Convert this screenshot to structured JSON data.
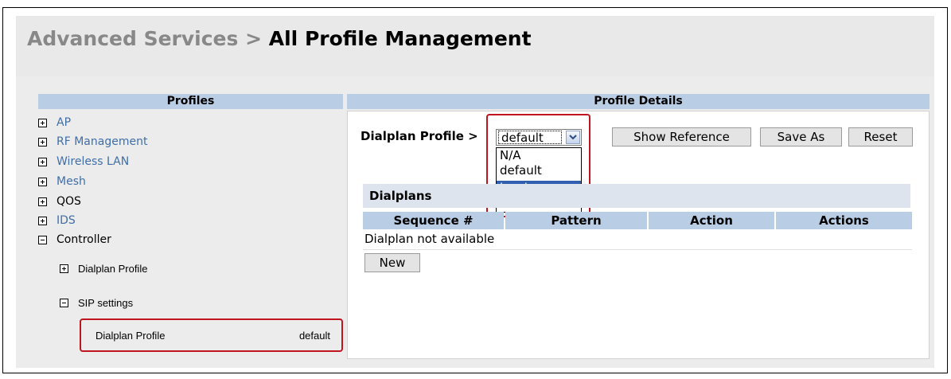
{
  "header": {
    "breadcrumb_parent": "Advanced Services > ",
    "page_title": "All Profile Management"
  },
  "profiles": {
    "header": "Profiles",
    "tree": [
      {
        "label": "AP",
        "expanded": false
      },
      {
        "label": "RF Management",
        "expanded": false
      },
      {
        "label": "Wireless LAN",
        "expanded": false
      },
      {
        "label": "Mesh",
        "expanded": false
      },
      {
        "label": "QOS",
        "expanded": false
      },
      {
        "label": "IDS",
        "expanded": false
      },
      {
        "label": "Controller",
        "expanded": true
      }
    ],
    "controller_children": [
      {
        "label": "Dialplan Profile",
        "expanded": false
      },
      {
        "label": "SIP settings",
        "expanded": true
      }
    ],
    "sip_child": {
      "label": "Dialplan Profile",
      "value": "default"
    }
  },
  "details": {
    "header": "Profile Details",
    "dialplan_label": "Dialplan Profile >",
    "select_value": "default",
    "dropdown_options": [
      "N/A",
      "default",
      "local",
      "--NEW--"
    ],
    "dropdown_highlighted": "local",
    "buttons": {
      "show_reference": "Show Reference",
      "save_as": "Save As",
      "reset": "Reset"
    },
    "dialplans": {
      "title": "Dialplans",
      "columns": [
        "Sequence #",
        "Pattern",
        "Action",
        "Actions"
      ],
      "empty_message": "Dialplan not available",
      "new_button": "New"
    }
  },
  "colors": {
    "section_header": "#b9cde5",
    "tree_link": "#3f6ea9",
    "highlight_border": "#c0141e",
    "selected_option": "#2f5fae"
  }
}
